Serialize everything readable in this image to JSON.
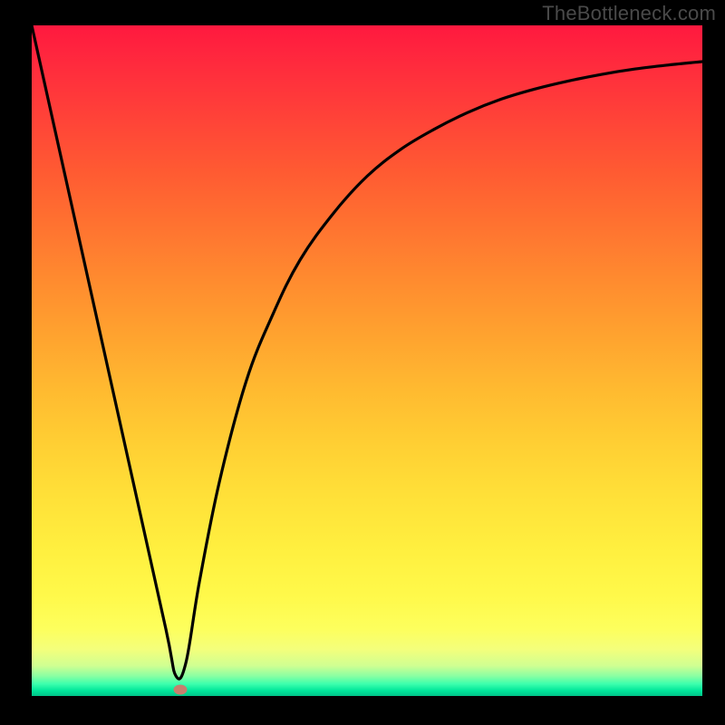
{
  "watermark": "TheBottleneck.com",
  "chart_data": {
    "type": "line",
    "title": "",
    "xlabel": "",
    "ylabel": "",
    "x_range": [
      0,
      100
    ],
    "y_range": [
      0,
      100
    ],
    "background": {
      "type": "vertical-gradient",
      "stops": [
        {
          "pos": 0,
          "color": "#ff193f"
        },
        {
          "pos": 50,
          "color": "#ffb930"
        },
        {
          "pos": 90,
          "color": "#fff94a"
        },
        {
          "pos": 100,
          "color": "#00c488"
        }
      ]
    },
    "series": [
      {
        "name": "bottleneck-curve",
        "color": "#000000",
        "x": [
          0,
          5,
          10,
          15,
          20,
          21.5,
          23,
          25,
          28,
          32,
          36,
          40,
          45,
          50,
          55,
          60,
          65,
          70,
          75,
          80,
          85,
          90,
          95,
          100
        ],
        "y": [
          100,
          77.5,
          55,
          32.5,
          10,
          3,
          5,
          17,
          32,
          47,
          57,
          65,
          72,
          77.5,
          81.5,
          84.5,
          87,
          89,
          90.5,
          91.7,
          92.7,
          93.5,
          94.1,
          94.6
        ]
      }
    ],
    "marker": {
      "x": 22.2,
      "y": 1.0,
      "color": "#c77f6e"
    }
  }
}
